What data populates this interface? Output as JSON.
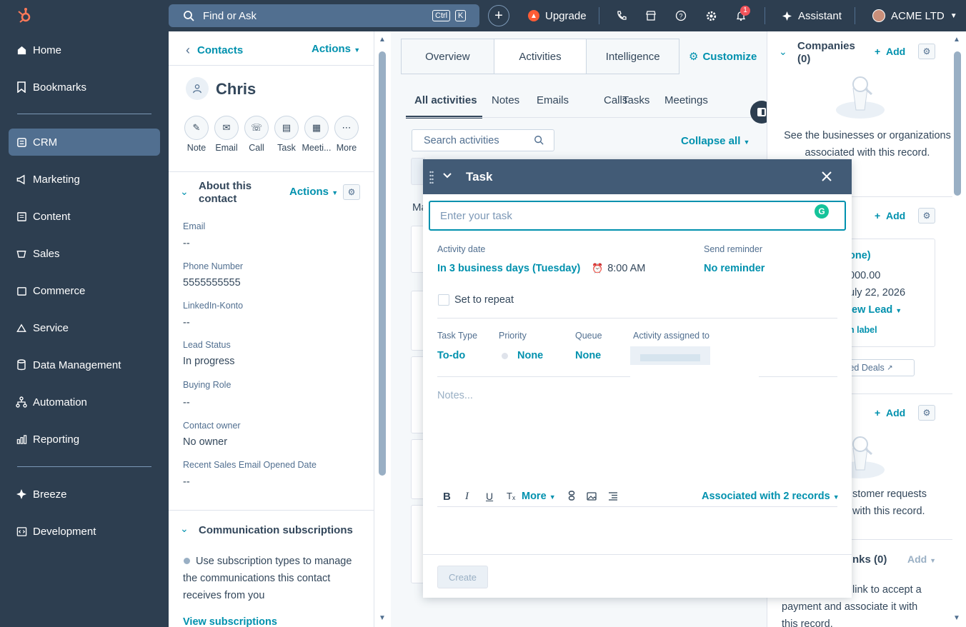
{
  "nav": {
    "items": [
      {
        "label": "Home",
        "icon": "home-icon"
      },
      {
        "label": "Bookmarks",
        "icon": "bookmark-icon"
      },
      {
        "label": "CRM",
        "icon": "crm-icon"
      },
      {
        "label": "Marketing",
        "icon": "megaphone-icon"
      },
      {
        "label": "Content",
        "icon": "content-icon"
      },
      {
        "label": "Sales",
        "icon": "sales-icon"
      },
      {
        "label": "Commerce",
        "icon": "commerce-icon"
      },
      {
        "label": "Service",
        "icon": "service-icon"
      },
      {
        "label": "Data Management",
        "icon": "database-icon"
      },
      {
        "label": "Automation",
        "icon": "automation-icon"
      },
      {
        "label": "Reporting",
        "icon": "reporting-icon"
      },
      {
        "label": "Breeze",
        "icon": "sparkle-icon"
      },
      {
        "label": "Development",
        "icon": "code-icon"
      }
    ]
  },
  "topbar": {
    "search_placeholder": "Find or Ask",
    "kbd_ctrl": "Ctrl",
    "kbd_k": "K",
    "upgrade": "Upgrade",
    "notifications_count": "1",
    "assistant": "Assistant",
    "account": "ACME LTD"
  },
  "record": {
    "back_label": "Contacts",
    "actions": "Actions",
    "name": "Chris",
    "quick_actions": [
      "Note",
      "Email",
      "Call",
      "Task",
      "Meeti...",
      "More"
    ],
    "about_title_1": "About this",
    "about_title_2": "contact",
    "about_actions": "Actions",
    "fields": [
      {
        "label": "Email",
        "value": "--"
      },
      {
        "label": "Phone Number",
        "value": "5555555555"
      },
      {
        "label": "LinkedIn-Konto",
        "value": "--"
      },
      {
        "label": "Lead Status",
        "value": "In progress"
      },
      {
        "label": "Buying Role",
        "value": "--"
      },
      {
        "label": "Contact owner",
        "value": "No owner"
      },
      {
        "label": "Recent Sales Email Opened Date",
        "value": "--"
      }
    ],
    "comm_title": "Communication subscriptions",
    "comm_text": "Use subscription types to manage the communications this contact receives from you",
    "view_subs": "View subscriptions"
  },
  "middle": {
    "tabs": [
      "Overview",
      "Activities",
      "Intelligence"
    ],
    "customize": "Customize",
    "subtabs": [
      "All activities",
      "Notes",
      "Emails",
      "Calls",
      "Tasks",
      "Meetings"
    ],
    "search_placeholder": "Search activities",
    "collapse_all": "Collapse all",
    "month_stub": "Ma"
  },
  "modal": {
    "title": "Task",
    "task_placeholder": "Enter your task",
    "activity_date_label": "Activity date",
    "activity_date_value": "In 3 business days (Tuesday)",
    "time": "8:00 AM",
    "reminder_label": "Send reminder",
    "reminder_value": "No reminder",
    "repeat_label": "Set to repeat",
    "task_type_label": "Task Type",
    "task_type_value": "To-do",
    "priority_label": "Priority",
    "priority_value": "None",
    "queue_label": "Queue",
    "queue_value": "None",
    "assigned_label": "Activity assigned to",
    "notes_placeholder": "Notes...",
    "more": "More",
    "associated": "Associated with 2 records",
    "create": "Create"
  },
  "right": {
    "companies_title_1": "Companies",
    "companies_title_2": "(0)",
    "add": "Add",
    "companies_empty": "See the businesses or organizations associated with this record.",
    "deal_name_frag": "one)",
    "deal_amount_frag": "000.00",
    "deal_date_frag": "uly 22, 2026",
    "deal_stage_frag": "lew Lead",
    "deal_label_frag": "n label",
    "related_deals_frag": "ted Deals",
    "tickets_empty_1": "stomer requests",
    "tickets_empty_2": "with this record.",
    "payment_links_frag": "nks (0)",
    "payment_add": "Add",
    "payment_text_1": "link to accept a",
    "payment_text_2": "payment and associate it with",
    "payment_text_3": "this record."
  },
  "colors": {
    "nav_bg": "#2d3e50",
    "active_nav": "#516f90",
    "link": "#0091ae",
    "modal_header": "#425b76",
    "upgrade": "#ff5c35",
    "badge": "#f2545b"
  }
}
